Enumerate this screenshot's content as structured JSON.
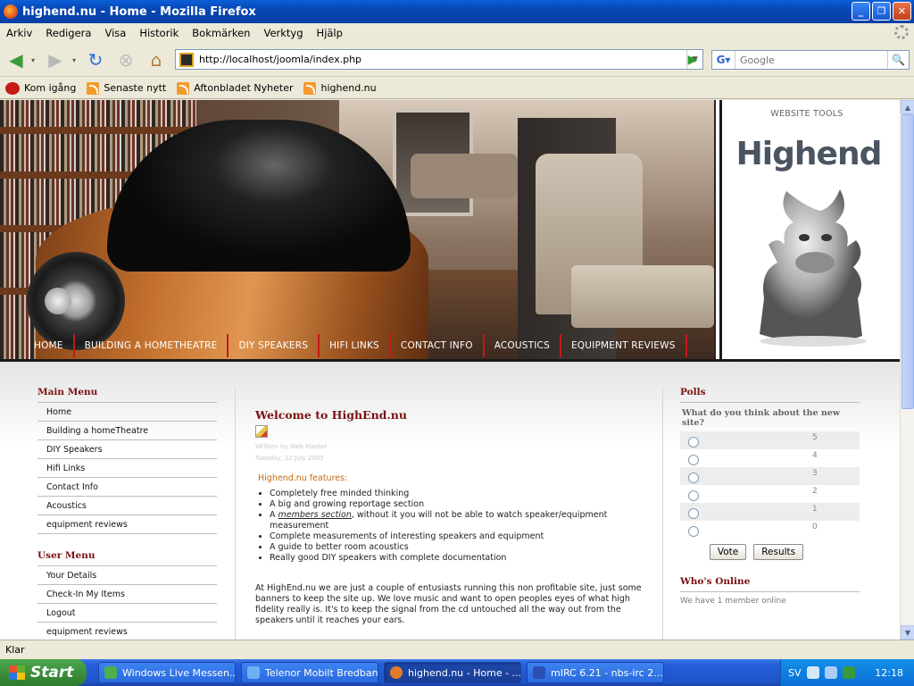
{
  "window": {
    "title": "highend.nu - Home - Mozilla Firefox"
  },
  "menubar": [
    "Arkiv",
    "Redigera",
    "Visa",
    "Historik",
    "Bokmärken",
    "Verktyg",
    "Hjälp"
  ],
  "navbar": {
    "url": "http://localhost/joomla/index.php",
    "search_placeholder": "Google"
  },
  "bookmarks": [
    "Kom igång",
    "Senaste nytt",
    "Aftonbladet Nyheter",
    "highend.nu"
  ],
  "site": {
    "topnav": [
      "HOME",
      "BUILDING A HOMETHEATRE",
      "DIY SPEAKERS",
      "HIFI LINKS",
      "CONTACT INFO",
      "ACOUSTICS",
      "EQUIPMENT REVIEWS"
    ],
    "website_tools": "WEBSITE TOOLS",
    "logo_text": "Highend",
    "main_menu": {
      "title": "Main Menu",
      "items": [
        "Home",
        "Building a homeTheatre",
        "DIY Speakers",
        "Hifi Links",
        "Contact Info",
        "Acoustics",
        "equipment reviews"
      ]
    },
    "user_menu": {
      "title": "User Menu",
      "items": [
        "Your Details",
        "Check-In My Items",
        "Logout",
        "equipment reviews"
      ]
    },
    "article": {
      "title": "Welcome to HighEnd.nu",
      "author": "Written by Web Master",
      "date": "Tuesday, 12 July 2005",
      "features_title": "Highend.nu features:",
      "features": [
        "Completely free minded thinking",
        "A big and growing reportage section",
        "Complete measurements of interesting speakers and equipment",
        "A guide to better room acoustics",
        "Really good DIY speakers with complete documentation"
      ],
      "members_prefix": "A ",
      "members_link": "members section",
      "members_suffix": ", without it you will not be able to watch speaker/equipment measurement",
      "paragraph": "At HighEnd.nu we are just a couple of entusiasts running this non profitable site, just some banners to keep the site up. We love music and want to open peoples eyes of what high fidelity really is. It's to keep the signal from the cd untouched all the way out from the speakers until it reaches your ears."
    },
    "polls": {
      "title": "Polls",
      "question": "What do you think about the new site?",
      "options": [
        "5",
        "4",
        "3",
        "2",
        "1",
        "0"
      ],
      "vote_label": "Vote",
      "results_label": "Results"
    },
    "whos_online": {
      "title": "Who's Online",
      "text": "We have 1 member online"
    }
  },
  "status": "Klar",
  "taskbar": {
    "start": "Start",
    "tasks": [
      "Windows Live Messen...",
      "Telenor Mobilt Bredband",
      "highend.nu - Home - ...",
      "mIRC 6.21 - nbs-irc 2..."
    ],
    "lang": "SV",
    "clock": "12:18"
  }
}
